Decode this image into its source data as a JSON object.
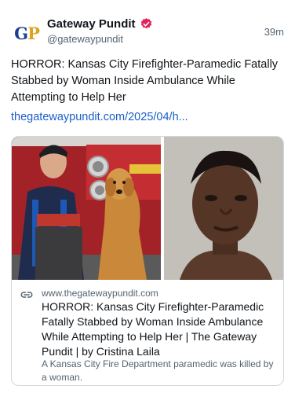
{
  "account": {
    "avatar_initials_g": "G",
    "avatar_initials_p": "P",
    "display_name": "Gateway Pundit",
    "handle": "@gatewaypundit",
    "timestamp": "39m",
    "verified_badge_color": "#e0245e"
  },
  "post": {
    "text": "HORROR: Kansas City Firefighter-Paramedic Fatally Stabbed by Woman Inside Ambulance While Attempting to Help Her",
    "link_text": "thegatewaypundit.com/2025/04/h..."
  },
  "card": {
    "domain": "www.thegatewaypundit.com",
    "title": "HORROR: Kansas City Firefighter-Paramedic Fatally Stabbed by Woman Inside Ambulance While Attempting to Help Her | The Gateway Pundit | by Cristina Laila",
    "description": "A Kansas City Fire Department paramedic was killed by a woman.",
    "icon": "link-icon"
  },
  "colors": {
    "link": "#1a5fc9",
    "muted": "#536471",
    "border": "#cfd9de"
  }
}
